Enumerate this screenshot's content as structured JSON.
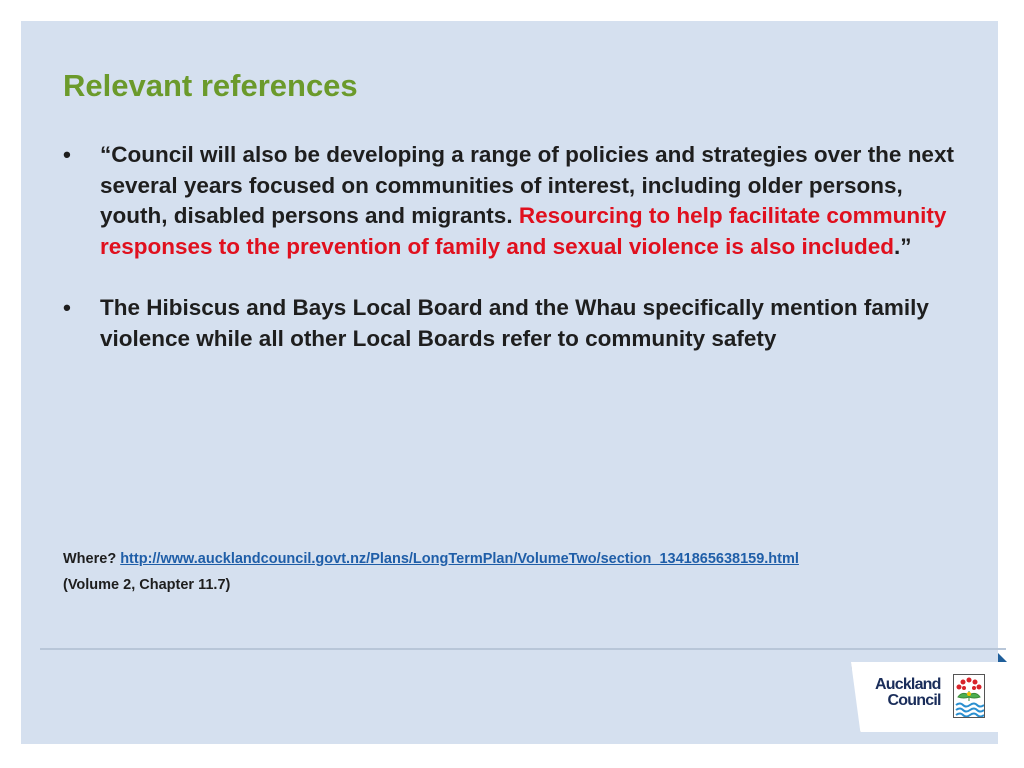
{
  "title": "Relevant references",
  "bullets": [
    {
      "marker": "•",
      "text": "“Council will also be developing a range of policies and strategies over the next several years focused on communities of interest, including older persons, youth, disabled persons and migrants. ",
      "highlight": "Resourcing to help facilitate community responses to the prevention of family and sexual violence is also included",
      "tail": ".”"
    },
    {
      "marker": "•",
      "text": "The Hibiscus and Bays Local Board and the Whau specifically mention family violence while all other Local Boards refer to community safety"
    }
  ],
  "where": {
    "label": "Where?",
    "link": "http://www.aucklandcouncil.govt.nz/Plans/LongTermPlan/VolumeTwo/section_1341865638159.html",
    "note": "(Volume 2, Chapter 11.7)"
  },
  "logo": {
    "line1": "Auckland",
    "line2": "Council"
  },
  "colors": {
    "title": "#6b9a2b",
    "highlight": "#e0101e",
    "background": "#d5e0ef"
  }
}
